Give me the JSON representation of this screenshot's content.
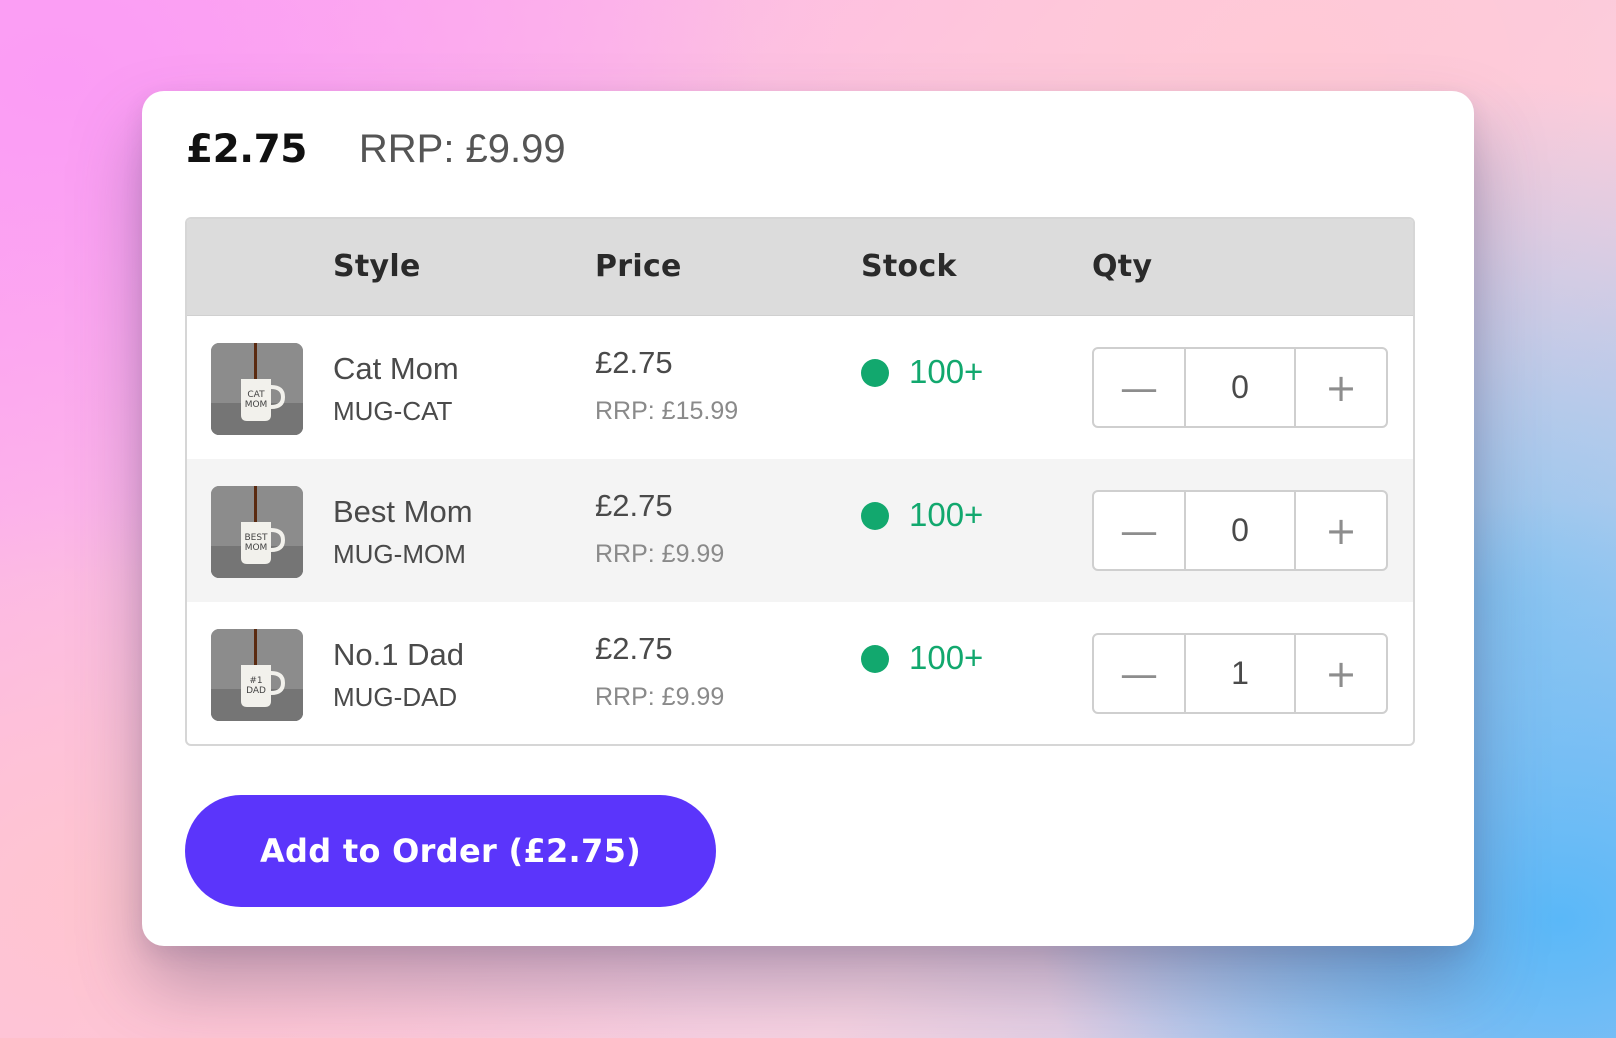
{
  "product": {
    "price": "£2.75",
    "rrp": "RRP: £9.99"
  },
  "table": {
    "headers": {
      "style": "Style",
      "price": "Price",
      "stock": "Stock",
      "qty": "Qty"
    },
    "rows": [
      {
        "name": "Cat Mom",
        "sku": "MUG-CAT",
        "price": "£2.75",
        "rrp": "RRP: £15.99",
        "stock": "100+",
        "qty": "0",
        "image_icon": "mug-cat-mom-image"
      },
      {
        "name": "Best Mom",
        "sku": "MUG-MOM",
        "price": "£2.75",
        "rrp": "RRP: £9.99",
        "stock": "100+",
        "qty": "0",
        "image_icon": "mug-best-mom-image"
      },
      {
        "name": "No.1 Dad",
        "sku": "MUG-DAD",
        "price": "£2.75",
        "rrp": "RRP: £9.99",
        "stock": "100+",
        "qty": "1",
        "image_icon": "mug-no1-dad-image"
      }
    ],
    "decrement_symbol": "—",
    "increment_symbol": "+"
  },
  "actions": {
    "add_to_order": "Add to Order (£2.75)"
  },
  "colors": {
    "accent": "#5b35fb",
    "in_stock": "#12a86e",
    "header_bg": "#dcdcdc"
  }
}
